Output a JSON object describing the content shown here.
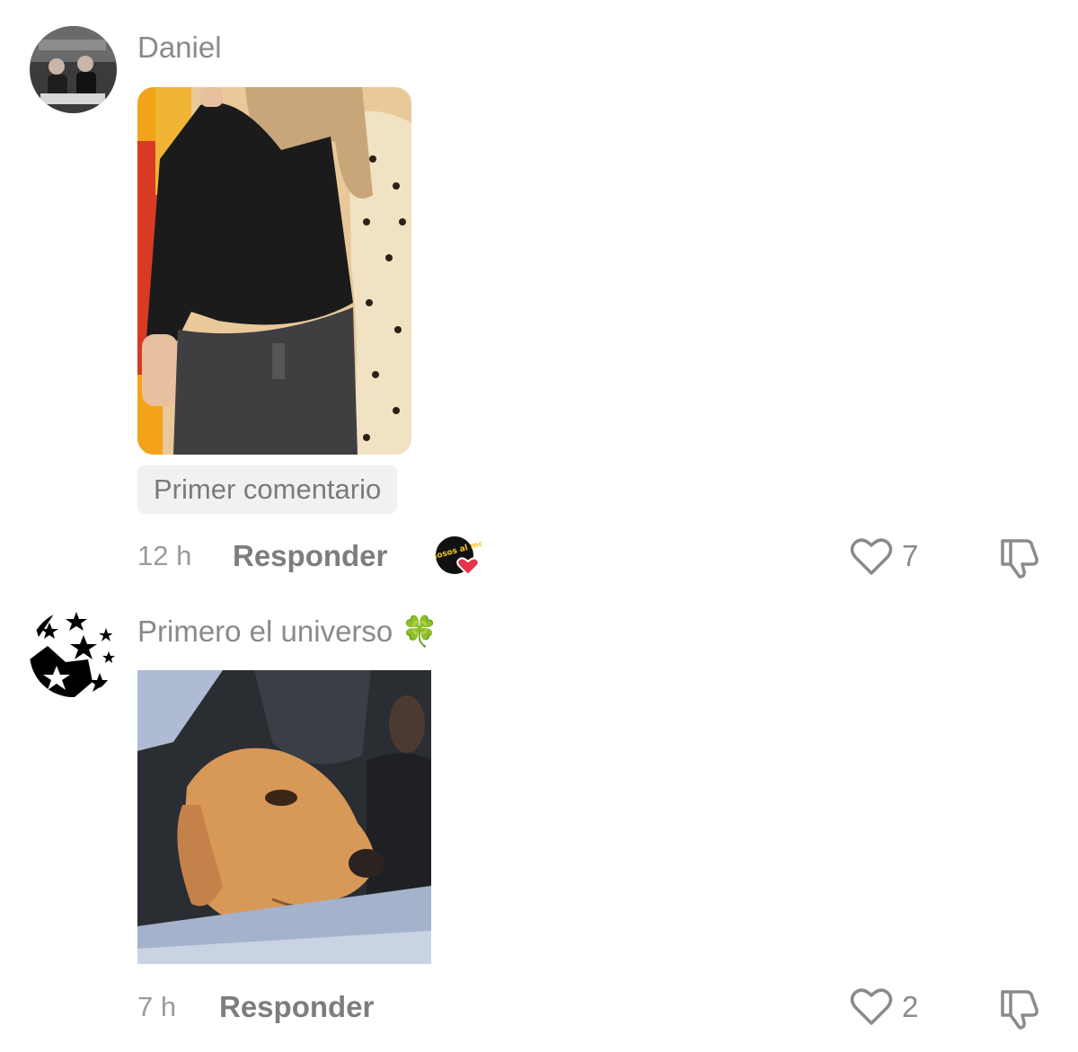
{
  "comments": [
    {
      "username": "Daniel",
      "tag": "Primer comentario",
      "time": "12 h",
      "reply_label": "Responder",
      "like_count": "7",
      "creator_badge_text": "famosos al mor"
    },
    {
      "username": "Primero el universo",
      "username_emoji": "🍀",
      "time": "7 h",
      "reply_label": "Responder",
      "like_count": "2"
    }
  ],
  "colors": {
    "muted_text": "#8a8a8a",
    "reply_text": "#7d7d7d",
    "tag_bg": "#f1f1f1",
    "heart_red": "#e8344a"
  }
}
